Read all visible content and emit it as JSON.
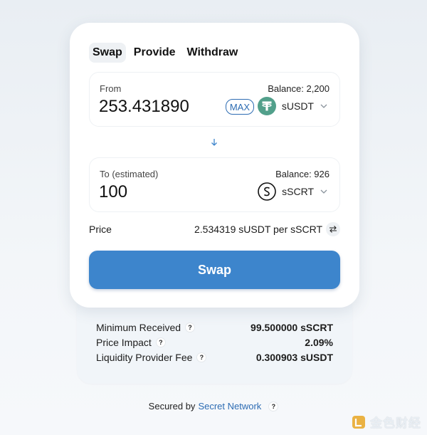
{
  "tabs": [
    {
      "label": "Swap",
      "active": true
    },
    {
      "label": "Provide",
      "active": false
    },
    {
      "label": "Withdraw",
      "active": false
    }
  ],
  "from": {
    "label": "From",
    "balance": "Balance: 2,200",
    "amount": "253.431890",
    "max_label": "MAX",
    "token": "sUSDT",
    "token_icon": "tether-icon",
    "token_color": "#52a08b"
  },
  "to": {
    "label": "To (estimated)",
    "balance": "Balance: 926",
    "amount": "100",
    "token": "sSCRT",
    "token_icon": "secret-icon"
  },
  "price": {
    "label": "Price",
    "value": "2.534319 sUSDT per sSCRT"
  },
  "swap_button": "Swap",
  "details": [
    {
      "label": "Minimum Received",
      "value": "99.500000 sSCRT"
    },
    {
      "label": "Price Impact",
      "value": "2.09%"
    },
    {
      "label": "Liquidity Provider Fee",
      "value": "0.300903 sUSDT"
    }
  ],
  "help_glyph": "?",
  "footer": {
    "prefix": "Secured by",
    "link": "Secret Network"
  },
  "watermark": "金色财经",
  "colors": {
    "accent": "#3d85cc",
    "link": "#2d6cb3"
  }
}
